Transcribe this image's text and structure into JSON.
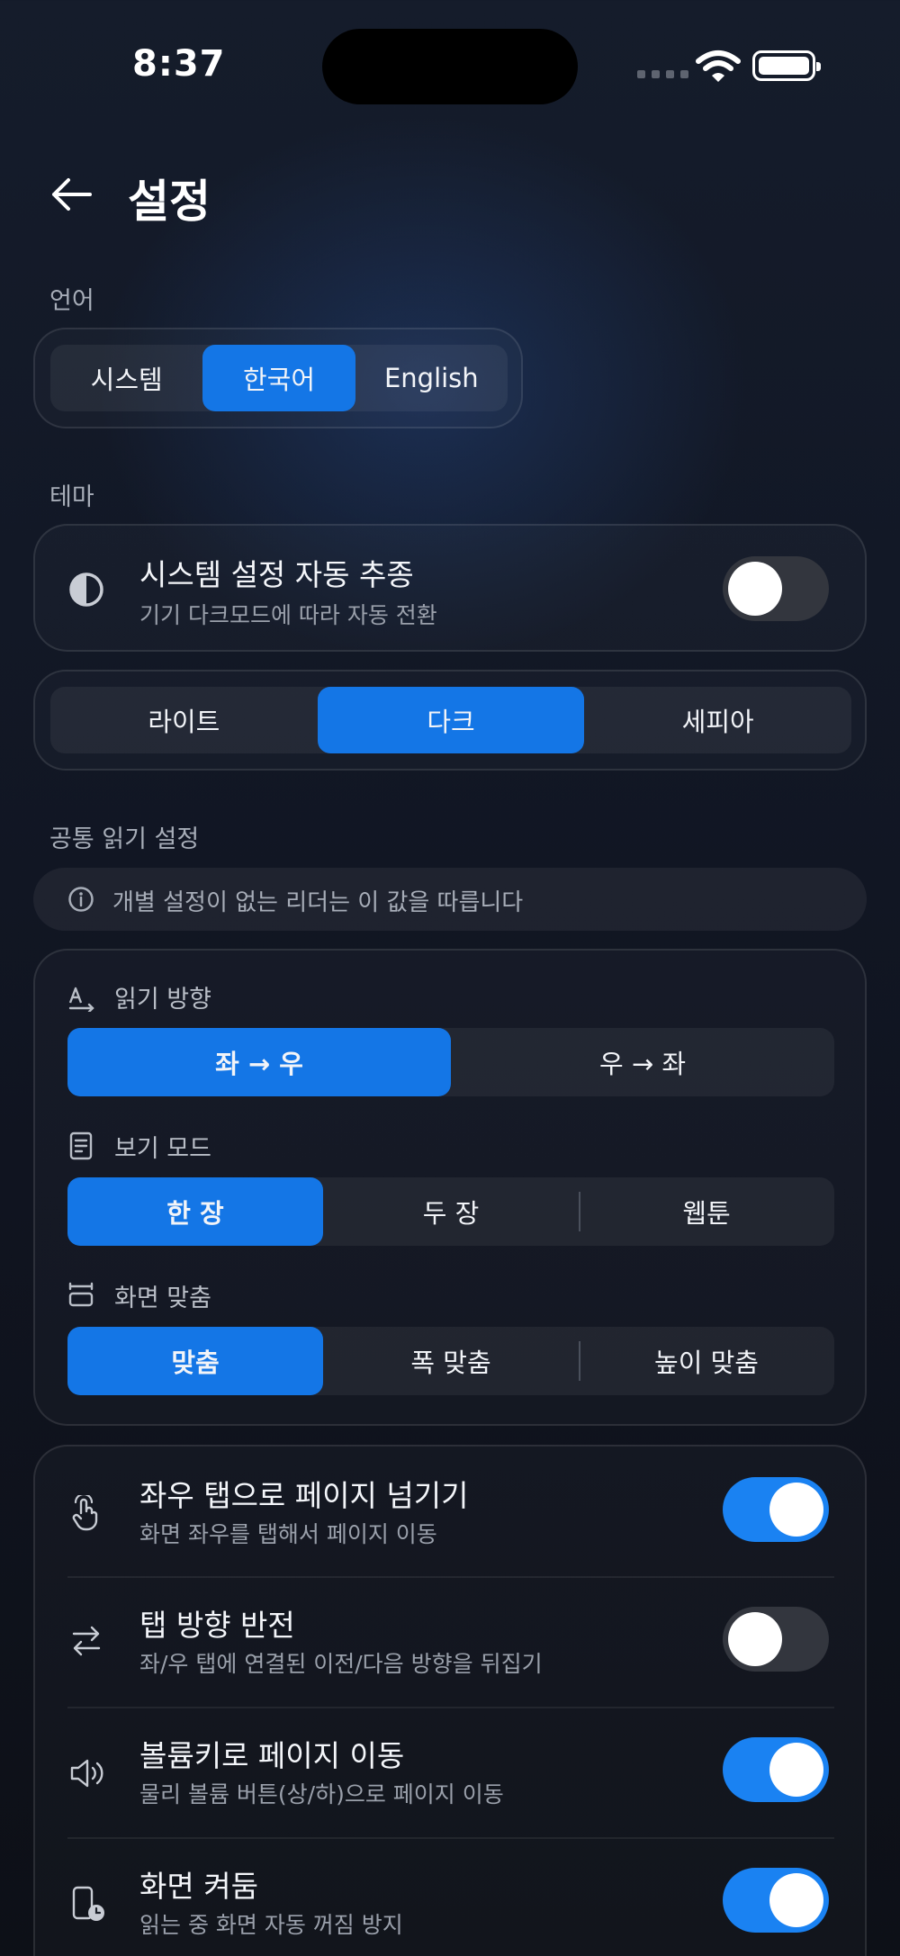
{
  "status_bar": {
    "time": "8:37"
  },
  "header": {
    "title": "설정"
  },
  "language": {
    "label": "언어",
    "options": [
      "시스템",
      "한국어",
      "English"
    ],
    "selected": "한국어"
  },
  "theme": {
    "label": "테마",
    "follow_system": {
      "title": "시스템 설정 자동 추종",
      "subtitle": "기기 다크모드에 따라 자동 전환",
      "enabled": false
    },
    "options": [
      "라이트",
      "다크",
      "세피아"
    ],
    "selected": "다크"
  },
  "reading": {
    "label": "공통 읽기 설정",
    "info": "개별 설정이 없는 리더는 이 값을 따릅니다",
    "direction": {
      "label": "읽기 방향",
      "options": [
        "좌 → 우",
        "우 → 좌"
      ],
      "selected": "좌 → 우"
    },
    "view_mode": {
      "label": "보기 모드",
      "options": [
        "한 장",
        "두 장",
        "웹툰"
      ],
      "selected": "한 장"
    },
    "fit": {
      "label": "화면 맞춤",
      "options": [
        "맞춤",
        "폭 맞춤",
        "높이 맞춤"
      ],
      "selected": "맞춤"
    }
  },
  "controls": [
    {
      "title": "좌우 탭으로 페이지 넘기기",
      "subtitle": "화면 좌우를 탭해서 페이지 이동",
      "enabled": true,
      "icon": "tap-hand-icon"
    },
    {
      "title": "탭 방향 반전",
      "subtitle": "좌/우 탭에 연결된 이전/다음 방향을 뒤집기",
      "enabled": false,
      "icon": "swap-arrows-icon"
    },
    {
      "title": "볼륨키로 페이지 이동",
      "subtitle": "물리 볼륨 버튼(상/하)으로 페이지 이동",
      "enabled": true,
      "icon": "speaker-icon"
    },
    {
      "title": "화면 켜둠",
      "subtitle": "읽는 중 화면 자동 꺼짐 방지",
      "enabled": true,
      "icon": "phone-clock-icon"
    }
  ],
  "colors": {
    "accent": "#1476e6",
    "toggle_on": "#1a82f2",
    "toggle_off": "#33363e"
  }
}
